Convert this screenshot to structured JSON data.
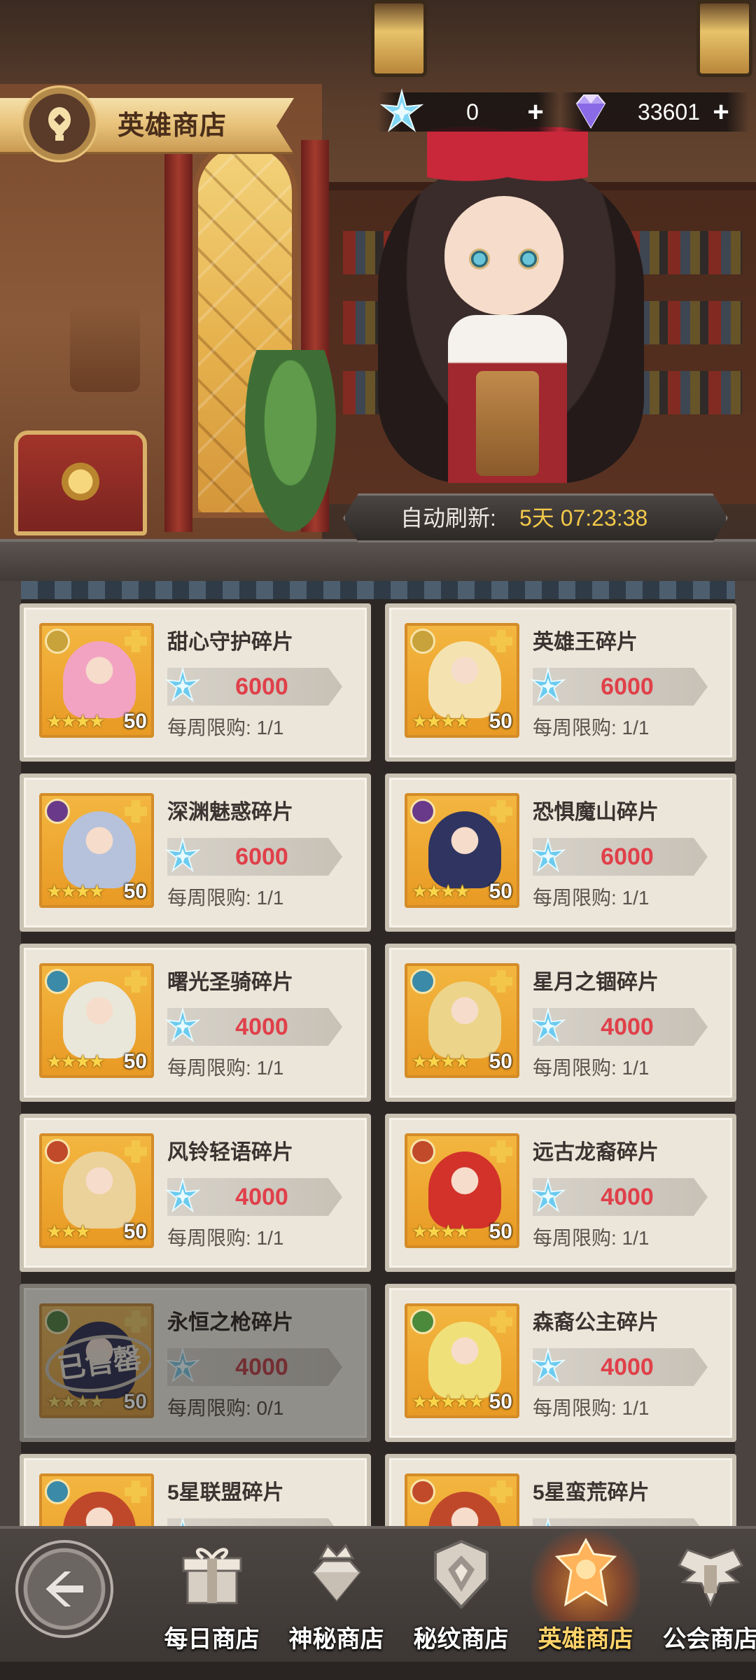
{
  "header": {
    "title": "英雄商店",
    "emblem_icon": "hot-air-balloon-icon"
  },
  "currencies": [
    {
      "icon": "snowflake-crystal-icon",
      "value": "0",
      "plus": "+"
    },
    {
      "icon": "diamond-gem-icon",
      "value": "33601",
      "plus": "+"
    }
  ],
  "refresh": {
    "label": "自动刷新:",
    "value": "5天 07:23:38"
  },
  "items": [
    {
      "name": "甜心守护碎片",
      "price": "6000",
      "limit": "每周限购: 1/1",
      "level": "50",
      "stars": "★★★★",
      "faction_color": "#c8a23a",
      "art_color": "#f2a3c2",
      "sold": false
    },
    {
      "name": "英雄王碎片",
      "price": "6000",
      "limit": "每周限购: 1/1",
      "level": "50",
      "stars": "★★★★",
      "faction_color": "#c8a23a",
      "art_color": "#f4e3b0",
      "sold": false
    },
    {
      "name": "深渊魅惑碎片",
      "price": "6000",
      "limit": "每周限购: 1/1",
      "level": "50",
      "stars": "★★★★",
      "faction_color": "#6a3a8a",
      "art_color": "#b6c2dc",
      "sold": false
    },
    {
      "name": "恐惧魔山碎片",
      "price": "6000",
      "limit": "每周限购: 1/1",
      "level": "50",
      "stars": "★★★★",
      "faction_color": "#6a3a8a",
      "art_color": "#2f3560",
      "sold": false
    },
    {
      "name": "曙光圣骑碎片",
      "price": "4000",
      "limit": "每周限购: 1/1",
      "level": "50",
      "stars": "★★★★",
      "faction_color": "#3a8aa8",
      "art_color": "#e9e6da",
      "sold": false
    },
    {
      "name": "星月之锢碎片",
      "price": "4000",
      "limit": "每周限购: 1/1",
      "level": "50",
      "stars": "★★★★",
      "faction_color": "#3a8aa8",
      "art_color": "#ecd48a",
      "sold": false
    },
    {
      "name": "风铃轻语碎片",
      "price": "4000",
      "limit": "每周限购: 1/1",
      "level": "50",
      "stars": "★★★",
      "faction_color": "#c04a2a",
      "art_color": "#ead29a",
      "sold": false
    },
    {
      "name": "远古龙裔碎片",
      "price": "4000",
      "limit": "每周限购: 1/1",
      "level": "50",
      "stars": "★★★★",
      "faction_color": "#c04a2a",
      "art_color": "#d2322a",
      "sold": false
    },
    {
      "name": "永恒之枪碎片",
      "price": "4000",
      "limit": "每周限购: 0/1",
      "level": "50",
      "stars": "★★★★",
      "faction_color": "#4a8a3a",
      "art_color": "#3a3a6a",
      "sold": true,
      "sold_label": "已售罄"
    },
    {
      "name": "森裔公主碎片",
      "price": "4000",
      "limit": "每周限购: 1/1",
      "level": "50",
      "stars": "★★★★★",
      "faction_color": "#4a8a3a",
      "art_color": "#f0e07a",
      "sold": false
    },
    {
      "name": "5星联盟碎片",
      "price": "",
      "limit": "",
      "level": "",
      "stars": "",
      "faction_color": "#3a8aa8",
      "art_color": "#c0482a",
      "sold": false
    },
    {
      "name": "5星蛮荒碎片",
      "price": "",
      "limit": "",
      "level": "",
      "stars": "",
      "faction_color": "#c04a2a",
      "art_color": "#c0482a",
      "sold": false
    }
  ],
  "nav": {
    "back_icon": "return-arrow-icon",
    "tabs": [
      {
        "label": "每日商店",
        "icon": "gift-box-icon",
        "active": false
      },
      {
        "label": "神秘商店",
        "icon": "diamond-crown-icon",
        "active": false
      },
      {
        "label": "秘纹商店",
        "icon": "rune-shield-icon",
        "active": false
      },
      {
        "label": "英雄商店",
        "icon": "hero-crest-icon",
        "active": true
      },
      {
        "label": "公会商店",
        "icon": "guild-wings-icon",
        "active": false
      }
    ]
  },
  "colors": {
    "price_red": "#e0404a",
    "refresh_gold": "#f2c94a",
    "tab_active": "#ffd36a",
    "portrait_frame": "#d48c28"
  }
}
